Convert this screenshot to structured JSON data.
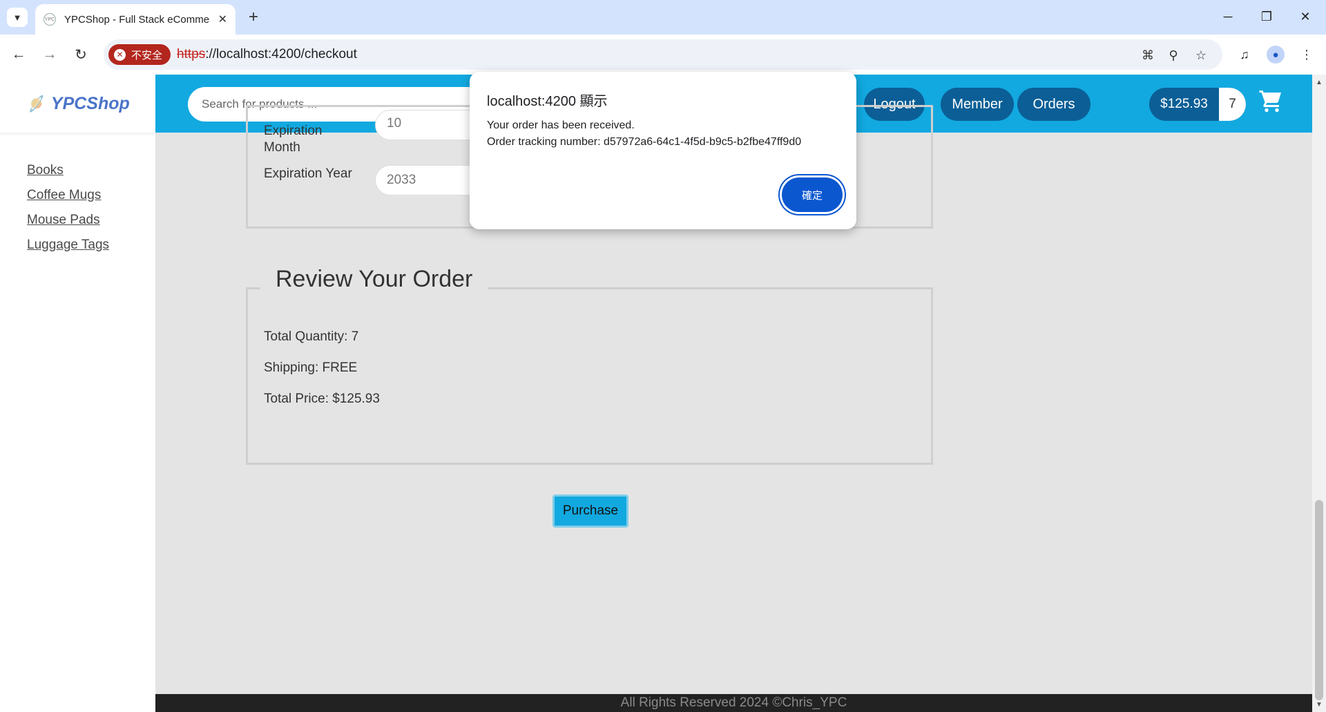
{
  "browser": {
    "tab_title": "YPCShop - Full Stack eCommerce",
    "favicon_text": "YPC",
    "security_label": "不安全",
    "url_scheme": "https",
    "url_rest": "://localhost:4200/checkout"
  },
  "brand": {
    "name": "YPCShop"
  },
  "sidebar": {
    "categories": [
      {
        "label": "Books"
      },
      {
        "label": "Coffee Mugs"
      },
      {
        "label": "Mouse Pads"
      },
      {
        "label": "Luggage Tags"
      }
    ]
  },
  "header": {
    "search_placeholder": "Search for products ...",
    "logout_label": "Logout",
    "member_label": "Member",
    "orders_label": "Orders",
    "cart_total": "$125.93",
    "cart_quantity": "7"
  },
  "payment_form": {
    "month_label": "Expiration Month",
    "month_value": "10",
    "year_label": "Expiration Year",
    "year_value": "2033"
  },
  "review": {
    "legend": "Review Your Order",
    "total_quantity": "Total Quantity: 7",
    "shipping": "Shipping: FREE",
    "total_price": "Total Price: $125.93"
  },
  "purchase_label": "Purchase",
  "footer_text": "All Rights Reserved 2024 ©Chris_YPC",
  "dialog": {
    "title": "localhost:4200 顯示",
    "message_line1": "Your order has been received.",
    "message_line2": "Order tracking number: d57972a6-64c1-4f5d-b9c5-b2fbe47ff9d0",
    "ok_label": "確定"
  },
  "colors": {
    "header": "#12a9e0",
    "header_button": "#0b5f96",
    "dialog_button": "#0b57d0",
    "insecure": "#b3261e"
  }
}
